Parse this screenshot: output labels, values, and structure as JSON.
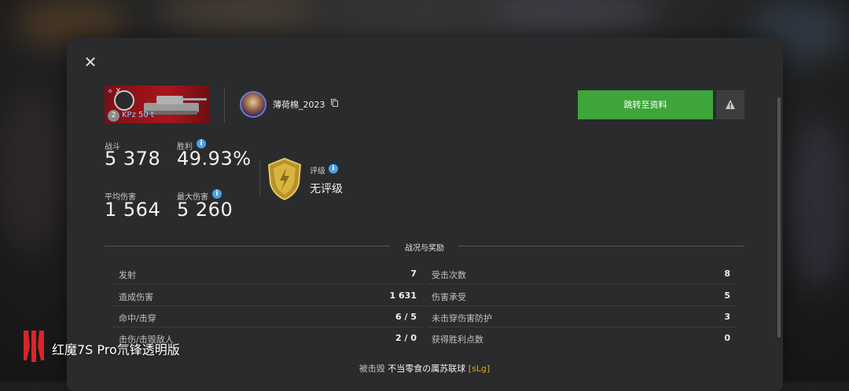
{
  "close_label": "✕",
  "tank": {
    "name": "KPz 50 t",
    "tier": "Ⅹ",
    "tier_circle": "2",
    "mark": "X"
  },
  "player": {
    "name": "薄荷棉_2023"
  },
  "buttons": {
    "profile": "跳转至资料"
  },
  "stats": {
    "battles": {
      "label": "战斗",
      "value": "5 378"
    },
    "winrate": {
      "label": "胜利",
      "value": "49.93%"
    },
    "avg_damage": {
      "label": "平均伤害",
      "value": "1 564"
    },
    "max_damage": {
      "label": "最大伤害",
      "value": "5 260"
    }
  },
  "rating": {
    "label": "评级",
    "value": "无评级"
  },
  "section": {
    "title": "战况与奖励"
  },
  "left_rows": [
    {
      "label": "发射",
      "value": "7"
    },
    {
      "label": "造成伤害",
      "value": "1 631"
    },
    {
      "label": "命中/击穿",
      "value": "6 / 5"
    },
    {
      "label": "击伤/击毁敌人",
      "value": "2 / 0"
    }
  ],
  "right_rows": [
    {
      "label": "受击次数",
      "value": "8"
    },
    {
      "label": "伤害承受",
      "value": "5"
    },
    {
      "label": "未击穿伤害防护",
      "value": "3"
    },
    {
      "label": "获得胜利点数",
      "value": "0"
    }
  ],
  "footer": {
    "prefix": "被击毁",
    "name": "不当零食の厲苏联球",
    "clan": "[sLg]"
  },
  "watermark": {
    "text": "红魔7S Pro氘锋透明版"
  },
  "colors": {
    "green": "#3da53a",
    "clan": "#e3a51a",
    "info": "#4aa3e8"
  }
}
